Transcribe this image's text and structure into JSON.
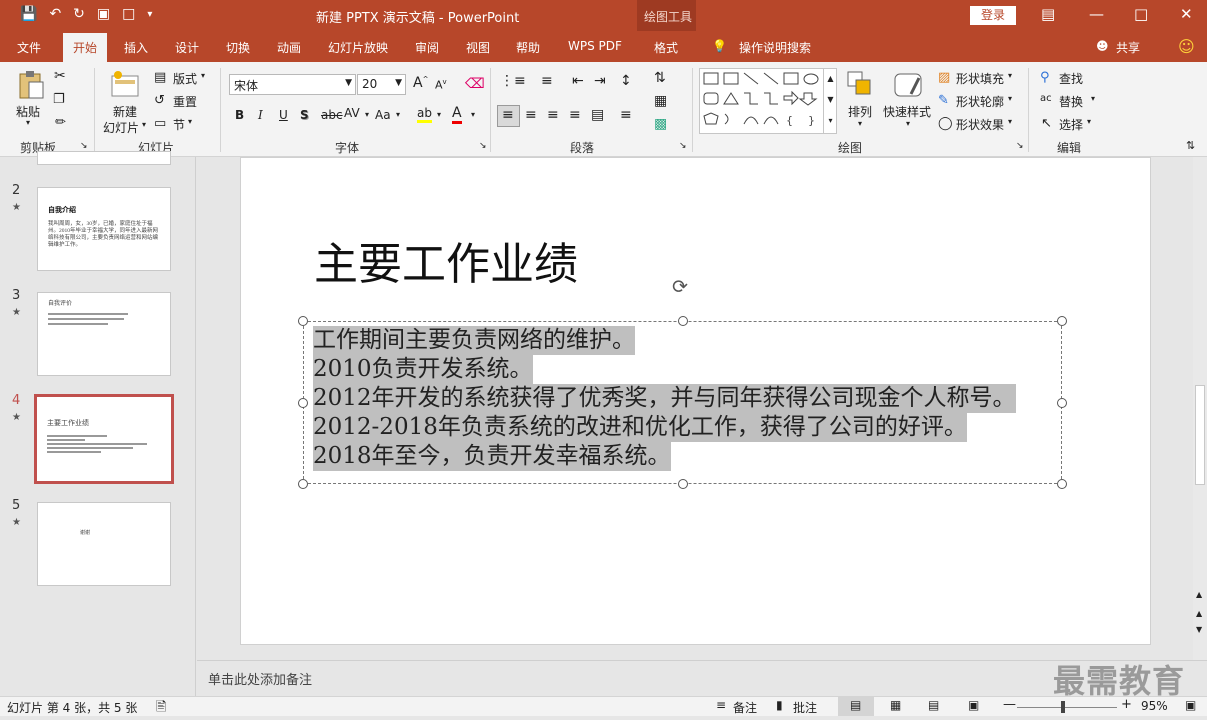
{
  "title_bar": {
    "doc_title": "新建 PPTX 演示文稿  -  PowerPoint",
    "context_group": "绘图工具",
    "login": "登录"
  },
  "tabs": [
    "文件",
    "开始",
    "插入",
    "设计",
    "切换",
    "动画",
    "幻灯片放映",
    "审阅",
    "视图",
    "帮助",
    "WPS PDF",
    "格式"
  ],
  "tell_me": "操作说明搜索",
  "share": "共享",
  "ribbon": {
    "clipboard": {
      "label": "剪贴板",
      "paste": "粘贴"
    },
    "slides": {
      "label": "幻灯片",
      "new_slide_1": "新建",
      "new_slide_2": "幻灯片",
      "layout": "版式",
      "reset": "重置",
      "section": "节"
    },
    "font": {
      "label": "字体",
      "font_name": "宋体",
      "font_size": "20",
      "bold": "B",
      "italic": "I",
      "underline": "U",
      "strike": "S",
      "aa": "Aa"
    },
    "paragraph": {
      "label": "段落"
    },
    "drawing": {
      "label": "绘图",
      "arrange": "排列",
      "quick_styles": "快速样式",
      "shape_fill": "形状填充",
      "shape_outline": "形状轮廓",
      "shape_effects": "形状效果"
    },
    "editing": {
      "label": "编辑",
      "find": "查找",
      "replace": "替换",
      "select": "选择"
    }
  },
  "thumbnails": [
    {
      "num": "2",
      "title": "自我介绍",
      "text": "我叫周周，女，30岁，已婚，家庭住址于福州。2010年毕业于幸福大学，同年进入最新网络科技有限公司，主要负责网络运营和网站编辑维护工作。"
    },
    {
      "num": "3",
      "title": "自我评价",
      "text": ""
    },
    {
      "num": "4",
      "title": "主要工作业绩",
      "text": ""
    },
    {
      "num": "5",
      "title": "",
      "text": "谢谢"
    }
  ],
  "slide": {
    "title": "主要工作业绩",
    "lines": [
      "工作期间主要负责网络的维护。",
      "2010负责开发系统。",
      "2012年开发的系统获得了优秀奖，并与同年获得公司现金个人称号。",
      "2012-2018年负责系统的改进和优化工作，获得了公司的好评。",
      "2018年至今，负责开发幸福系统。"
    ]
  },
  "notes_placeholder": "单击此处添加备注",
  "status": {
    "slide_info": "幻灯片 第 4 张，共 5 张",
    "notes": "备注",
    "comments": "批注",
    "zoom": "95%"
  },
  "watermark": "最需教育",
  "colors": {
    "accent": "#b7472a",
    "selection": "#c0504d"
  }
}
